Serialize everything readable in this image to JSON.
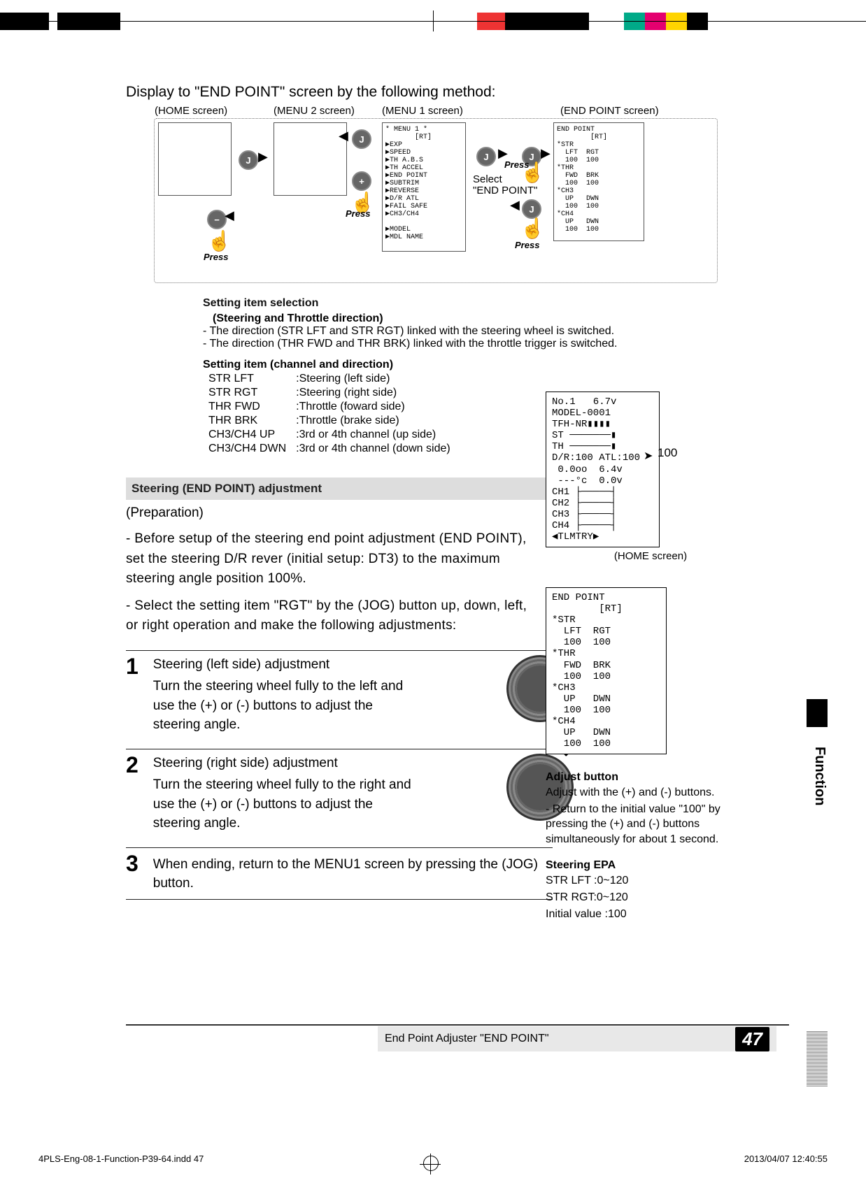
{
  "intro": "Display to \"END POINT\" screen by the following method:",
  "nav": {
    "home_label": "(HOME screen)",
    "menu2_label": "(MENU 2 screen)",
    "menu1_label": "(MENU 1 screen)",
    "endpoint_label": "(END POINT screen)",
    "select_text1": "Select",
    "select_text2": "\"END POINT\"",
    "press": "Press",
    "jog": "J",
    "plus": "+",
    "minus": "−",
    "menu1_text": "* MENU 1 *\n       [RT]\n▶EXP\n▶SPEED\n▶TH A.B.S\n▶TH ACCEL\n▶END POINT\n▶SUBTRIM\n▶REVERSE\n▶D/R ATL\n▶FAIL SAFE\n▶CH3/CH4\n\n▶MODEL\n▶MDL NAME",
    "endpoint_text": "END POINT\n        [RT]\n*STR\n  LFT  RGT\n  100  100\n*THR\n  FWD  BRK\n  100  100\n*CH3\n  UP   DWN\n  100  100\n*CH4\n  UP   DWN\n  100  100"
  },
  "setting": {
    "title": "Setting item selection",
    "subtitle": "(Steering and Throttle direction)",
    "line1": "- The direction (STR LFT and STR RGT) linked with the steering wheel is switched.",
    "line2": "- The direction (THR FWD and THR BRK) linked with the throttle trigger is switched.",
    "items_title": "Setting item (channel and direction)",
    "items": [
      {
        "k": "STR LFT",
        "v": ":Steering (left side)"
      },
      {
        "k": "STR RGT",
        "v": ":Steering (right side)"
      },
      {
        "k": "THR FWD",
        "v": ":Throttle (foward side)"
      },
      {
        "k": "THR BRK",
        "v": ":Throttle (brake side)"
      },
      {
        "k": "CH3/CH4 UP",
        "v": ":3rd or 4th channel (up side)"
      },
      {
        "k": "CH3/CH4 DWN",
        "v": ":3rd or 4th channel (down side)"
      }
    ]
  },
  "section_title": "Steering (END POINT) adjustment",
  "preparation": "(Preparation)",
  "prep1": "- Before setup of the steering end point adjustment (END POINT), set the steering D/R rever (initial setup: DT3) to the maximum steering angle position 100%.",
  "prep2": "- Select the setting item \"RGT\" by the (JOG) button up, down, left, or right operation and make the following adjustments:",
  "steps": [
    {
      "n": "1",
      "title": "Steering (left side) adjustment",
      "body": "Turn the steering wheel fully to the left and use the (+) or (-) buttons to adjust the steering angle."
    },
    {
      "n": "2",
      "title": "Steering (right side) adjustment",
      "body": "Turn the steering wheel fully to the right and use the (+) or (-) buttons to adjust the steering angle."
    },
    {
      "n": "3",
      "title": "",
      "body": "When ending, return to the MENU1 screen by pressing the (JOG) button."
    }
  ],
  "home_screen": {
    "text": "No.1   6.7v\nMODEL-0001\nTFH-NR▮▮▮▮\nST ───────▮\nTH ───────▮\nD/R:100 ATL:100\n 0.0oo  6.4v\n ---°c  0.0v\nCH1 ├─────┤\nCH2 ├─────┤\nCH3 ├─────┤\nCH4 ├─────┤\n◀TLMTRY▶",
    "label": "(HOME screen)",
    "pointer": "100"
  },
  "endpoint_screen": {
    "text": "END POINT\n        [RT]\n*STR\n  LFT  RGT\n  100  100\n*THR\n  FWD  BRK\n  100  100\n*CH3\n  UP   DWN\n  100  100\n*CH4\n  UP   DWN\n  100  100"
  },
  "adjust": {
    "title": "Adjust button",
    "l1": "Adjust with the (+) and (-) buttons.",
    "l2": "- Return to the initial value \"100\" by pressing the (+) and (-) buttons simultaneously for about 1 second."
  },
  "epa": {
    "title": "Steering EPA",
    "l1": "STR LFT :0~120",
    "l2": "STR RGT:0~120",
    "l3": "Initial value :100"
  },
  "side_tab": "Function",
  "footer_caption": "End Point Adjuster  \"END POINT\"",
  "page_number": "47",
  "print_foot_left": "4PLS-Eng-08-1-Function-P39-64.indd   47",
  "print_foot_right": "2013/04/07   12:40:55"
}
